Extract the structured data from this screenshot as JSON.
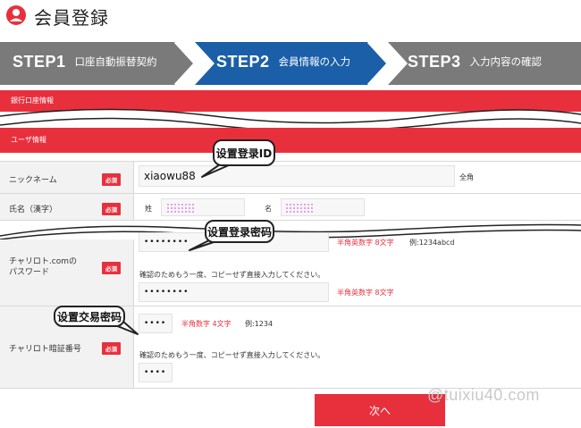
{
  "page": {
    "title": "会員登録"
  },
  "steps": [
    {
      "num": "STEP1",
      "desc": "口座自動振替契約"
    },
    {
      "num": "STEP2",
      "desc": "会員情報の入力"
    },
    {
      "num": "STEP3",
      "desc": "入力内容の確認"
    }
  ],
  "sections": {
    "bank": "銀行口座情報",
    "user": "ユーザ情報"
  },
  "form": {
    "required_badge": "必須",
    "nickname": {
      "label": "ニックネーム",
      "value": "xiaowu88",
      "note": "全角"
    },
    "name": {
      "label": "氏名（漢字）",
      "last_label": "姓",
      "first_label": "名"
    },
    "password": {
      "label_line1": "チャリロト.comの",
      "label_line2": "パスワード",
      "value": "••••••••",
      "hint_red": "半角英数字 8文字",
      "example": "例:1234abcd",
      "confirm_note": "確認のためもう一度、コピーせず直接入力してください。",
      "confirm_value": "••••••••",
      "confirm_hint_red": "半角英数字 8文字"
    },
    "pin": {
      "label": "チャリロト暗証番号",
      "value": "••••",
      "hint_red": "半角数字 4文字",
      "example": "例:1234",
      "confirm_note": "確認のためもう一度、コピーせず直接入力してください。",
      "confirm_value": "••••"
    }
  },
  "callouts": {
    "id": "设置登录ID",
    "password": "设置登录密码",
    "pin": "设置交易密码"
  },
  "buttons": {
    "next": "次へ"
  },
  "watermark": "@tuixiu40.com",
  "colors": {
    "accent": "#e8303d",
    "step_active": "#1a5fa8",
    "step_inactive": "#7a7a7a"
  }
}
